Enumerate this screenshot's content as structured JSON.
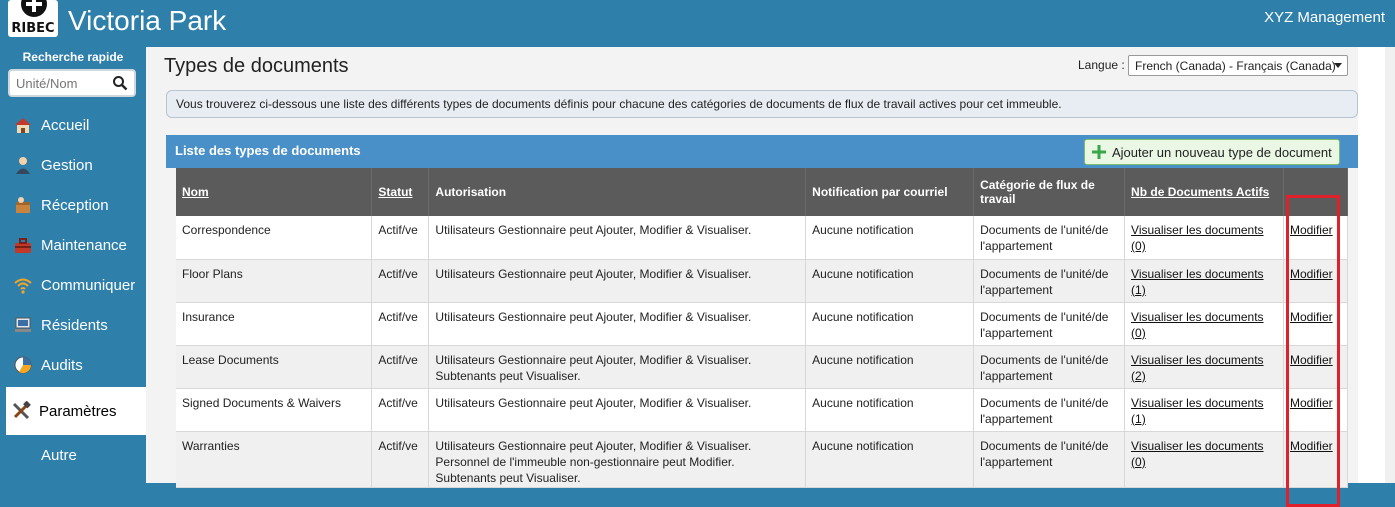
{
  "header": {
    "logo_text": "RIBEC",
    "app_title": "Victoria Park",
    "company": "XYZ Management"
  },
  "sidebar": {
    "quick_search_label": "Recherche rapide",
    "search_placeholder": "Unité/Nom",
    "items": [
      {
        "label": "Accueil",
        "icon": "home-icon"
      },
      {
        "label": "Gestion",
        "icon": "person-icon"
      },
      {
        "label": "Réception",
        "icon": "package-icon"
      },
      {
        "label": "Maintenance",
        "icon": "toolbox-icon"
      },
      {
        "label": "Communiquer",
        "icon": "wifi-icon"
      },
      {
        "label": "Résidents",
        "icon": "computer-icon"
      },
      {
        "label": "Audits",
        "icon": "pie-chart-icon"
      },
      {
        "label": "Paramètres",
        "icon": "tools-icon",
        "active": true
      },
      {
        "label": "Autre",
        "icon": ""
      }
    ]
  },
  "main": {
    "title": "Types de documents",
    "language_label": "Langue :",
    "language_value": "French (Canada) - Français (Canada)",
    "info": "Vous trouverez ci-dessous une liste des différents types de documents définis pour chacune des catégories de documents de flux de travail actives pour cet immeuble.",
    "panel_title": "Liste des types de documents",
    "add_button": "Ajouter un nouveau type de document",
    "columns": [
      "Nom",
      "Statut",
      "Autorisation",
      "Notification par courriel",
      "Catégorie de flux de travail",
      "Nb de Documents Actifs",
      ""
    ],
    "rows": [
      {
        "name": "Correspondence",
        "status": "Actif/ve",
        "auth": "Utilisateurs Gestionnaire peut Ajouter, Modifier & Visualiser.",
        "notif": "Aucune notification",
        "category": "Documents de l'unité/de l'appartement",
        "docs": "Visualiser les documents (0)",
        "action": "Modifier"
      },
      {
        "name": "Floor Plans",
        "status": "Actif/ve",
        "auth": "Utilisateurs Gestionnaire peut Ajouter, Modifier & Visualiser.",
        "notif": "Aucune notification",
        "category": "Documents de l'unité/de l'appartement",
        "docs": "Visualiser les documents (1)",
        "action": "Modifier"
      },
      {
        "name": "Insurance",
        "status": "Actif/ve",
        "auth": "Utilisateurs Gestionnaire peut Ajouter, Modifier & Visualiser.",
        "notif": "Aucune notification",
        "category": "Documents de l'unité/de l'appartement",
        "docs": "Visualiser les documents (0)",
        "action": "Modifier"
      },
      {
        "name": "Lease Documents",
        "status": "Actif/ve",
        "auth": "Utilisateurs Gestionnaire peut Ajouter, Modifier & Visualiser.\nSubtenants peut Visualiser.",
        "notif": "Aucune notification",
        "category": "Documents de l'unité/de l'appartement",
        "docs": "Visualiser les documents (2)",
        "action": "Modifier"
      },
      {
        "name": "Signed Documents & Waivers",
        "status": "Actif/ve",
        "auth": "Utilisateurs Gestionnaire peut Ajouter, Modifier & Visualiser.",
        "notif": "Aucune notification",
        "category": "Documents de l'unité/de l'appartement",
        "docs": "Visualiser les documents (1)",
        "action": "Modifier"
      },
      {
        "name": "Warranties",
        "status": "Actif/ve",
        "auth": "Utilisateurs Gestionnaire peut Ajouter, Modifier & Visualiser.\nPersonnel de l'immeuble non-gestionnaire peut Modifier.\nSubtenants peut Visualiser.",
        "notif": "Aucune notification",
        "category": "Documents de l'unité/de l'appartement",
        "docs": "Visualiser les documents (0)",
        "action": "Modifier"
      }
    ]
  },
  "colors": {
    "brand": "#2f7fab",
    "panel_header": "#4a90c8",
    "table_header": "#5b5b5b",
    "highlight": "#e0202a",
    "add_button_icon": "#3aa64a"
  }
}
